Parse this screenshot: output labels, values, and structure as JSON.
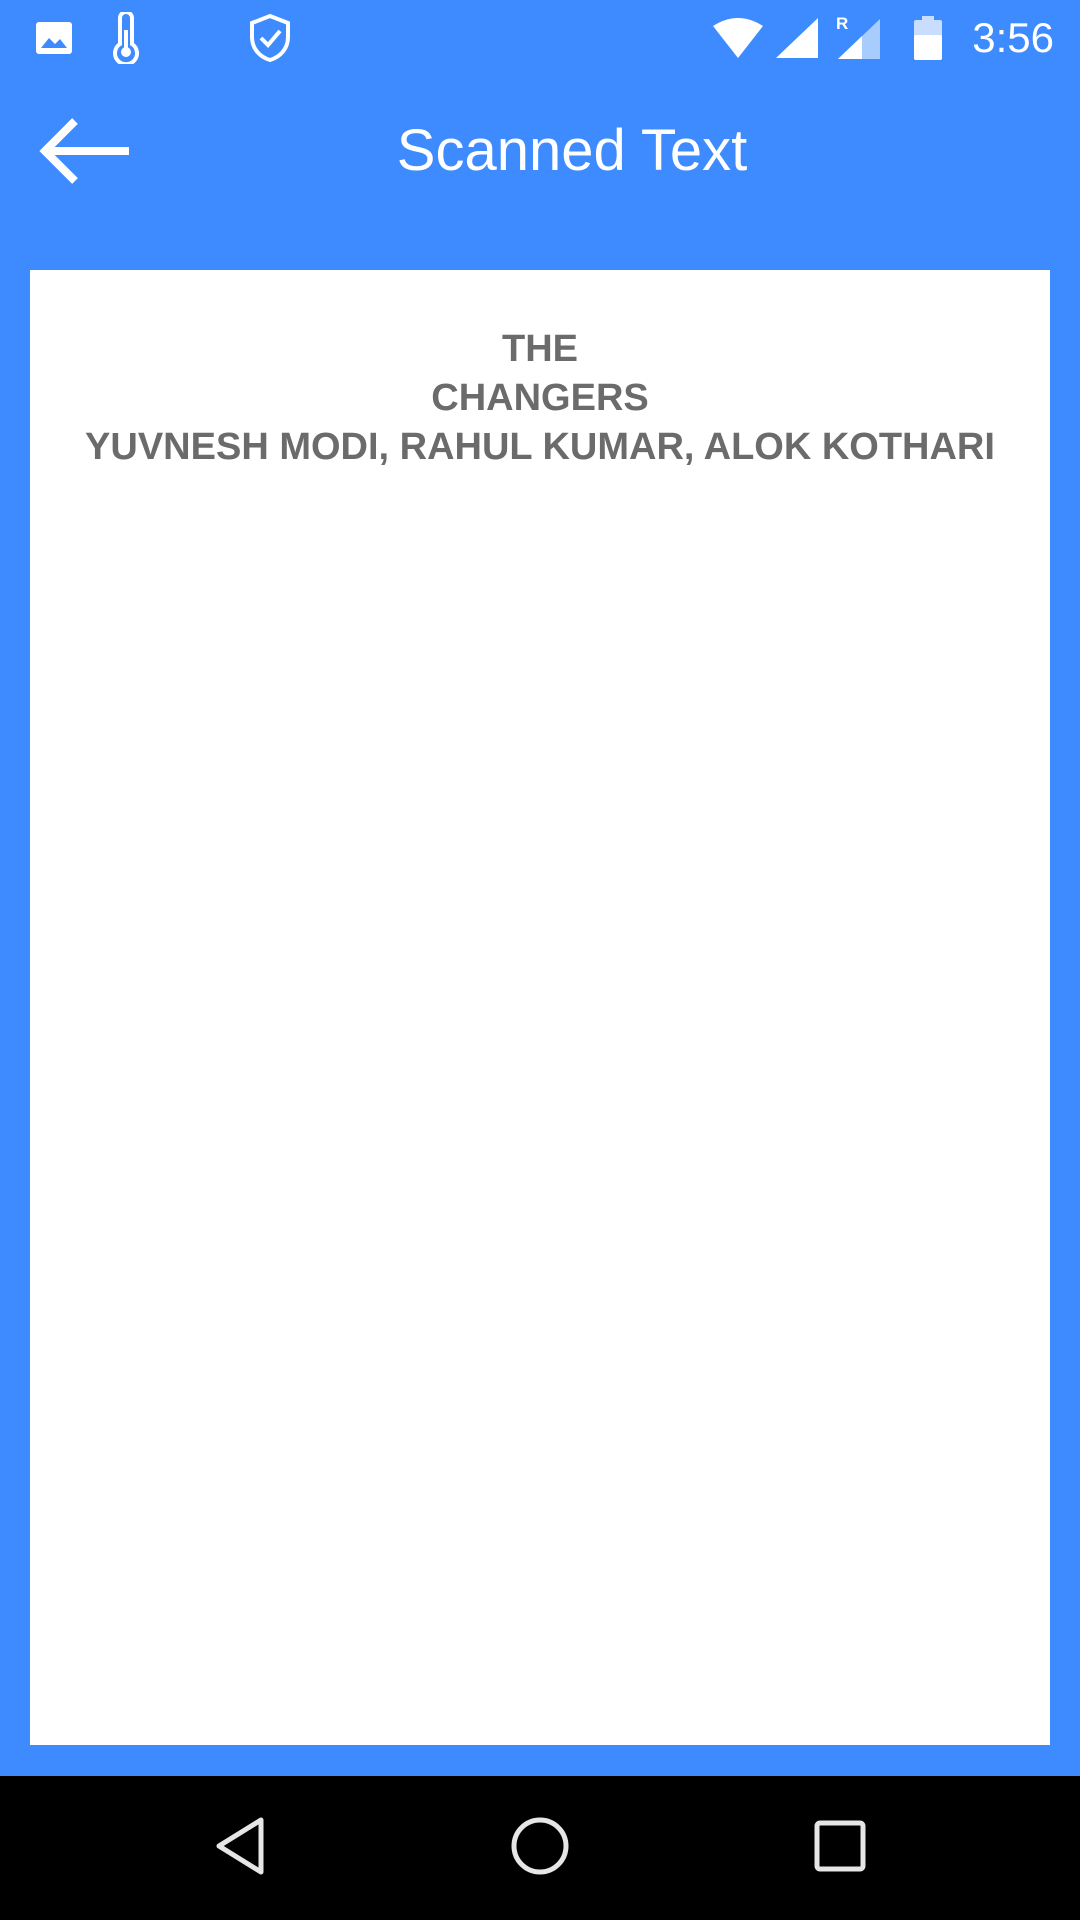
{
  "status_bar": {
    "time": "3:56",
    "icons": [
      "image-icon",
      "thermometer-icon",
      "shield-check-icon",
      "wifi-icon",
      "cell-signal-icon",
      "cell-signal-roaming-icon",
      "battery-icon"
    ],
    "roaming_label": "R"
  },
  "app_bar": {
    "title": "Scanned Text",
    "back_icon": "arrow-back-icon"
  },
  "scanned_text": {
    "lines": [
      "THE",
      "CHANGERS",
      "YUVNESH MODI, RAHUL KUMAR, ALOK KOTHARI"
    ]
  },
  "nav_bar": {
    "icons": [
      "back-triangle-icon",
      "home-circle-icon",
      "recents-square-icon"
    ]
  },
  "colors": {
    "primary": "#3d8bff",
    "card": "#ffffff",
    "text": "#6b6b6b",
    "nav": "#000000"
  }
}
